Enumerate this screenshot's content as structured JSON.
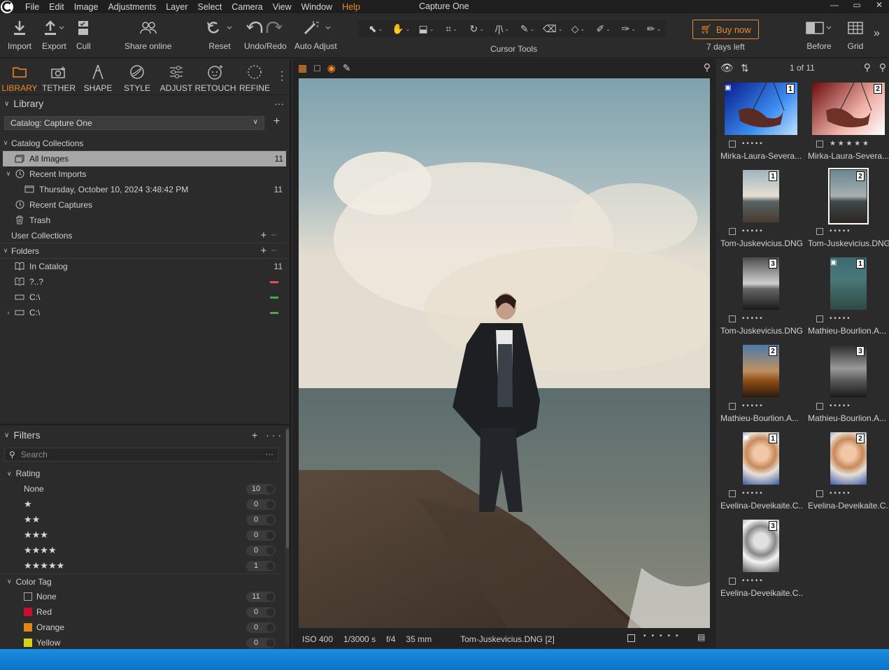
{
  "menubar": {
    "items": [
      "File",
      "Edit",
      "Image",
      "Adjustments",
      "Layer",
      "Select",
      "Camera",
      "View",
      "Window",
      "Help"
    ],
    "title": "Capture One"
  },
  "toolbar": {
    "import": "Import",
    "export": "Export",
    "cull": "Cull",
    "share": "Share online",
    "reset": "Reset",
    "undo_redo": "Undo/Redo",
    "auto_adjust": "Auto Adjust",
    "cursor_tools": "Cursor Tools",
    "buy_now": "Buy now",
    "days_left": "7 days left",
    "before": "Before",
    "grid": "Grid"
  },
  "tool_tabs": [
    "LIBRARY",
    "TETHER",
    "SHAPE",
    "STYLE",
    "ADJUST",
    "RETOUCH",
    "REFINE"
  ],
  "library": {
    "title": "Library",
    "catalog": "Catalog: Capture One",
    "catalog_collections": "Catalog Collections",
    "all_images": "All Images",
    "all_images_count": "11",
    "recent_imports": "Recent Imports",
    "import_date": "Thursday, October 10, 2024 3:48:42 PM",
    "import_count": "11",
    "recent_captures": "Recent Captures",
    "trash": "Trash",
    "user_collections": "User Collections",
    "folders": "Folders",
    "in_catalog": "In Catalog",
    "in_catalog_count": "11",
    "unknown_folder": "?..?",
    "drive1": "C:\\",
    "drive2": "C:\\"
  },
  "filters": {
    "title": "Filters",
    "search_placeholder": "Search",
    "rating_title": "Rating",
    "ratings": [
      {
        "label": "None",
        "count": "10"
      },
      {
        "stars": "★",
        "count": "0"
      },
      {
        "stars": "★★",
        "count": "0"
      },
      {
        "stars": "★★★",
        "count": "0"
      },
      {
        "stars": "★★★★",
        "count": "0"
      },
      {
        "stars": "★★★★★",
        "count": "1"
      }
    ],
    "color_tag_title": "Color Tag",
    "color_tags": [
      {
        "label": "None",
        "count": "11",
        "color": ""
      },
      {
        "label": "Red",
        "count": "0",
        "color": "#c8102e"
      },
      {
        "label": "Orange",
        "count": "0",
        "color": "#e0861a"
      },
      {
        "label": "Yellow",
        "count": "0",
        "color": "#d4d21a"
      }
    ]
  },
  "viewer": {
    "iso": "ISO 400",
    "shutter": "1/3000 s",
    "aperture": "f/4",
    "focal": "35 mm",
    "filename": "Tom-Juskevicius.DNG [2]"
  },
  "browser": {
    "counter": "1 of 11",
    "thumbs": [
      {
        "name": "Mirka-Laura-Severa...",
        "badge": "1",
        "rating": "• • • • •"
      },
      {
        "name": "Mirka-Laura-Severa...",
        "badge": "2",
        "rating": "★ ★ ★ ★ ★"
      },
      {
        "name": "Tom-Juskevicius.DNG",
        "badge": "1",
        "rating": "• • • • •"
      },
      {
        "name": "Tom-Juskevicius.DNG",
        "badge": "2",
        "rating": "• • • • •"
      },
      {
        "name": "Tom-Juskevicius.DNG",
        "badge": "3",
        "rating": "• • • • •"
      },
      {
        "name": "Mathieu-Bourlion.A...",
        "badge": "1",
        "rating": "• • • • •"
      },
      {
        "name": "Mathieu-Bourlion.A...",
        "badge": "2",
        "rating": "• • • • •"
      },
      {
        "name": "Mathieu-Bourlion.A...",
        "badge": "3",
        "rating": "• • • • •"
      },
      {
        "name": "Evelina-Deveikaite.C...",
        "badge": "1",
        "rating": "• • • • •"
      },
      {
        "name": "Evelina-Deveikaite.C...",
        "badge": "2",
        "rating": "• • • • •"
      },
      {
        "name": "Evelina-Deveikaite.C...",
        "badge": "3",
        "rating": "• • • • •"
      }
    ]
  },
  "colors": {
    "accent": "#f08a24",
    "panel": "#2b2b2b"
  }
}
